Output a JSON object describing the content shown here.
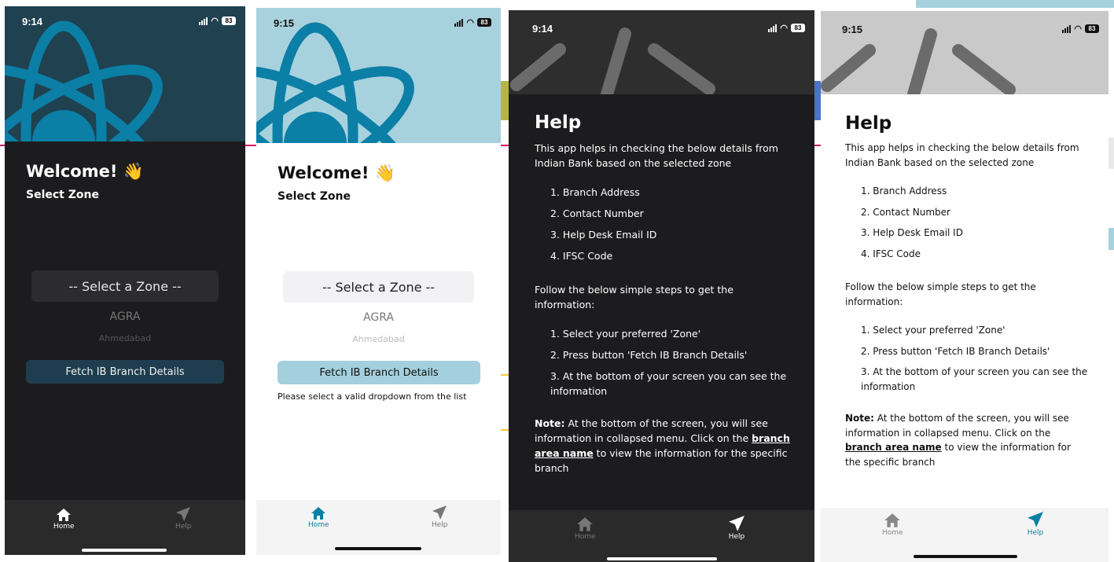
{
  "colors": {
    "react_blue": "#0b7fa6",
    "hero_dark": "#1f4150",
    "hero_light": "#a8d1de",
    "dark_bg": "#1c1c1e",
    "active_tab_dark": "#ffffff",
    "active_tab_light": "#0b7fa6"
  },
  "screens": [
    {
      "theme": "dark",
      "time": "9:14",
      "battery": "83",
      "welcome": "Welcome! 👋",
      "select_zone_label": "Select Zone",
      "picker_selected": "-- Select a Zone --",
      "picker_next": "AGRA",
      "picker_next2": "Ahmedabad",
      "fetch_button": "Fetch IB Branch Details",
      "error": "",
      "tabs": [
        {
          "label": "Home",
          "icon": "home-icon"
        },
        {
          "label": "Help",
          "icon": "send-icon"
        }
      ],
      "active_tab": "Home"
    },
    {
      "theme": "light",
      "time": "9:15",
      "battery": "83",
      "welcome": "Welcome! 👋",
      "select_zone_label": "Select Zone",
      "picker_selected": "-- Select a Zone --",
      "picker_next": "AGRA",
      "picker_next2": "Ahmedabad",
      "fetch_button": "Fetch IB Branch Details",
      "error": "Please select a valid dropdown from the list",
      "tabs": [
        {
          "label": "Home",
          "icon": "home-icon"
        },
        {
          "label": "Help",
          "icon": "send-icon"
        }
      ],
      "active_tab": "Home"
    },
    {
      "theme": "dark",
      "time": "9:14",
      "battery": "83",
      "tabs": [
        {
          "label": "Home",
          "icon": "home-icon"
        },
        {
          "label": "Help",
          "icon": "send-icon"
        }
      ],
      "active_tab": "Help"
    },
    {
      "theme": "light",
      "time": "9:15",
      "battery": "83",
      "tabs": [
        {
          "label": "Home",
          "icon": "home-icon"
        },
        {
          "label": "Help",
          "icon": "send-icon"
        }
      ],
      "active_tab": "Help"
    }
  ],
  "help": {
    "title": "Help",
    "intro": "This app helps in checking the below details from Indian Bank based on the selected zone",
    "details": [
      "1. Branch Address",
      "2. Contact Number",
      "3. Help Desk Email ID",
      "4. IFSC Code"
    ],
    "steps_intro": "Follow the below simple steps to get the information:",
    "steps": [
      "1. Select your preferred 'Zone'",
      "2. Press button 'Fetch IB Branch Details'",
      "3. At the bottom of your screen you can see the information"
    ],
    "note_label": "Note:",
    "note_text": " At the bottom of the screen, you will see information in collapsed menu. Click on the ",
    "note_link": "branch area name",
    "note_end": "  to view the information for the specific branch"
  }
}
